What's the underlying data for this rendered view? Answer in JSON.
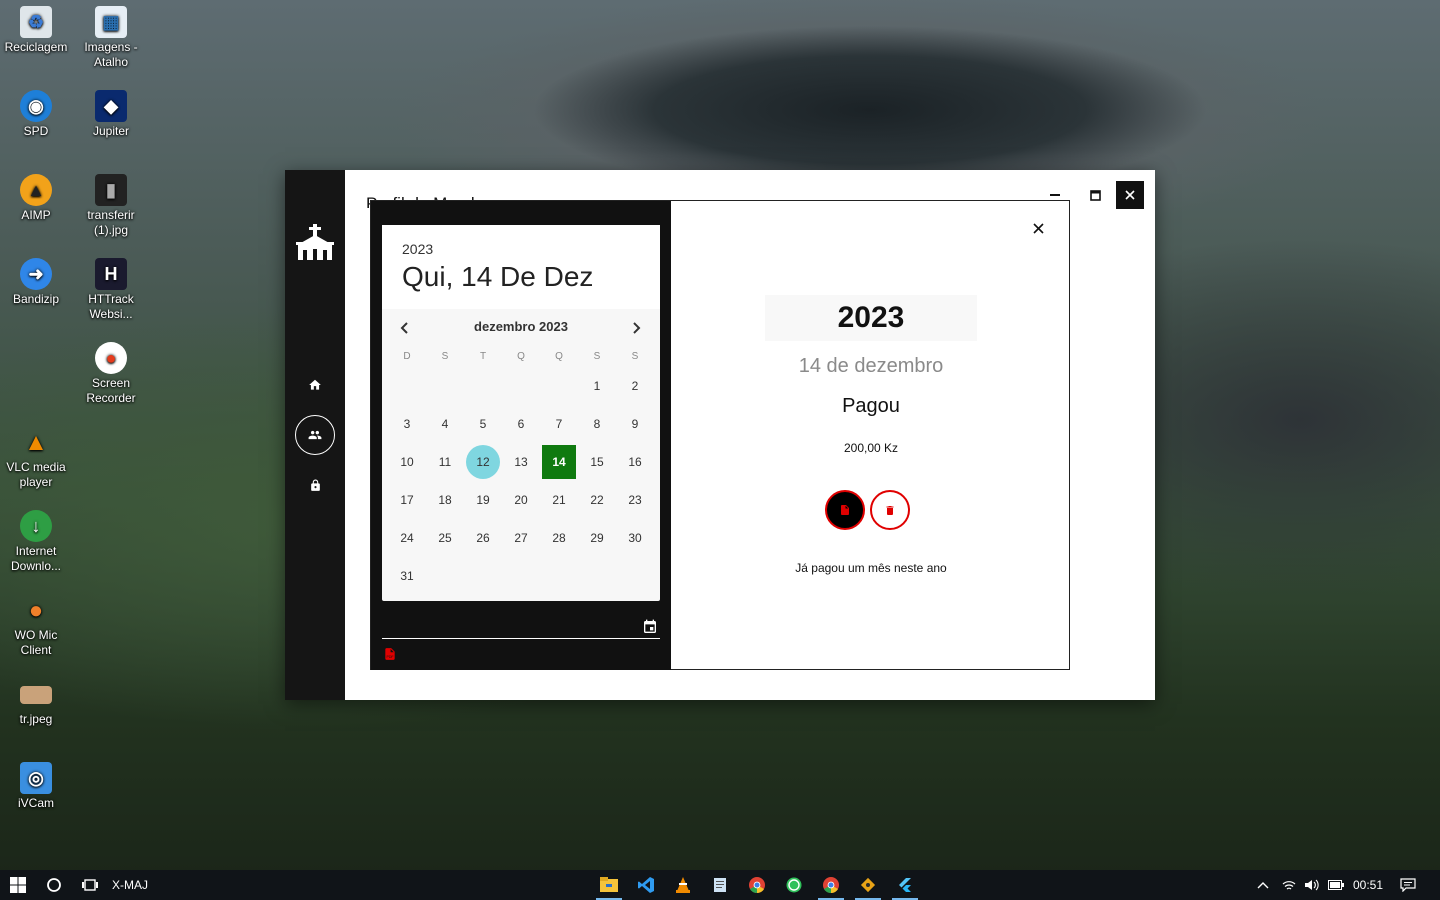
{
  "desktop": {
    "icons": [
      {
        "label": "Reciclagem",
        "icon": "recycle-bin-icon"
      },
      {
        "label": "Imagens - Atalho",
        "icon": "images-shortcut-icon"
      },
      {
        "label": "SPD",
        "icon": "spd-icon"
      },
      {
        "label": "Jupiter",
        "icon": "jupiter-icon"
      },
      {
        "label": "AIMP",
        "icon": "aimp-icon"
      },
      {
        "label": "transferir (1).jpg",
        "icon": "image-file-icon"
      },
      {
        "label": "Bandizip",
        "icon": "bandizip-icon"
      },
      {
        "label": "HTTrack Websi...",
        "icon": "httrack-icon"
      },
      {
        "label": "Screen Recorder",
        "icon": "screen-recorder-icon"
      },
      {
        "label": "VLC media player",
        "icon": "vlc-icon"
      },
      {
        "label": "Internet Downlo...",
        "icon": "idm-icon"
      },
      {
        "label": "WO Mic Client",
        "icon": "wo-mic-icon"
      },
      {
        "label": "tr.jpeg",
        "icon": "image-file-icon"
      },
      {
        "label": "iVCam",
        "icon": "ivcam-icon"
      }
    ]
  },
  "window": {
    "title": "Perfil do Membro"
  },
  "calendar": {
    "year": "2023",
    "selected_date": "Qui, 14 De Dez",
    "month_label": "dezembro 2023",
    "weekdays": [
      "D",
      "S",
      "T",
      "Q",
      "Q",
      "S",
      "S"
    ],
    "days": [
      "1",
      "2",
      "3",
      "4",
      "5",
      "6",
      "7",
      "8",
      "9",
      "10",
      "11",
      "12",
      "13",
      "14",
      "15",
      "16",
      "17",
      "18",
      "19",
      "20",
      "21",
      "22",
      "23",
      "24",
      "25",
      "26",
      "27",
      "28",
      "29",
      "30",
      "31"
    ],
    "first_weekday_index": 5,
    "today": "12",
    "selected": "14",
    "accent_selected": "#0f7a0f",
    "accent_today": "#7fd6e0"
  },
  "detail": {
    "year": "2023",
    "date": "14 de dezembro",
    "status": "Pagou",
    "amount": "200,00 Kz",
    "message": "Já pagou um mês neste ano",
    "danger_color": "#e00000"
  },
  "taskbar": {
    "search_text": "X-MAJ",
    "clock": "00:51",
    "apps": [
      "file-explorer-icon",
      "vscode-icon",
      "vlc-icon",
      "notepad-icon",
      "chrome-icon",
      "whatsapp-icon",
      "chrome-icon",
      "git-icon",
      "flutter-app-icon"
    ]
  }
}
